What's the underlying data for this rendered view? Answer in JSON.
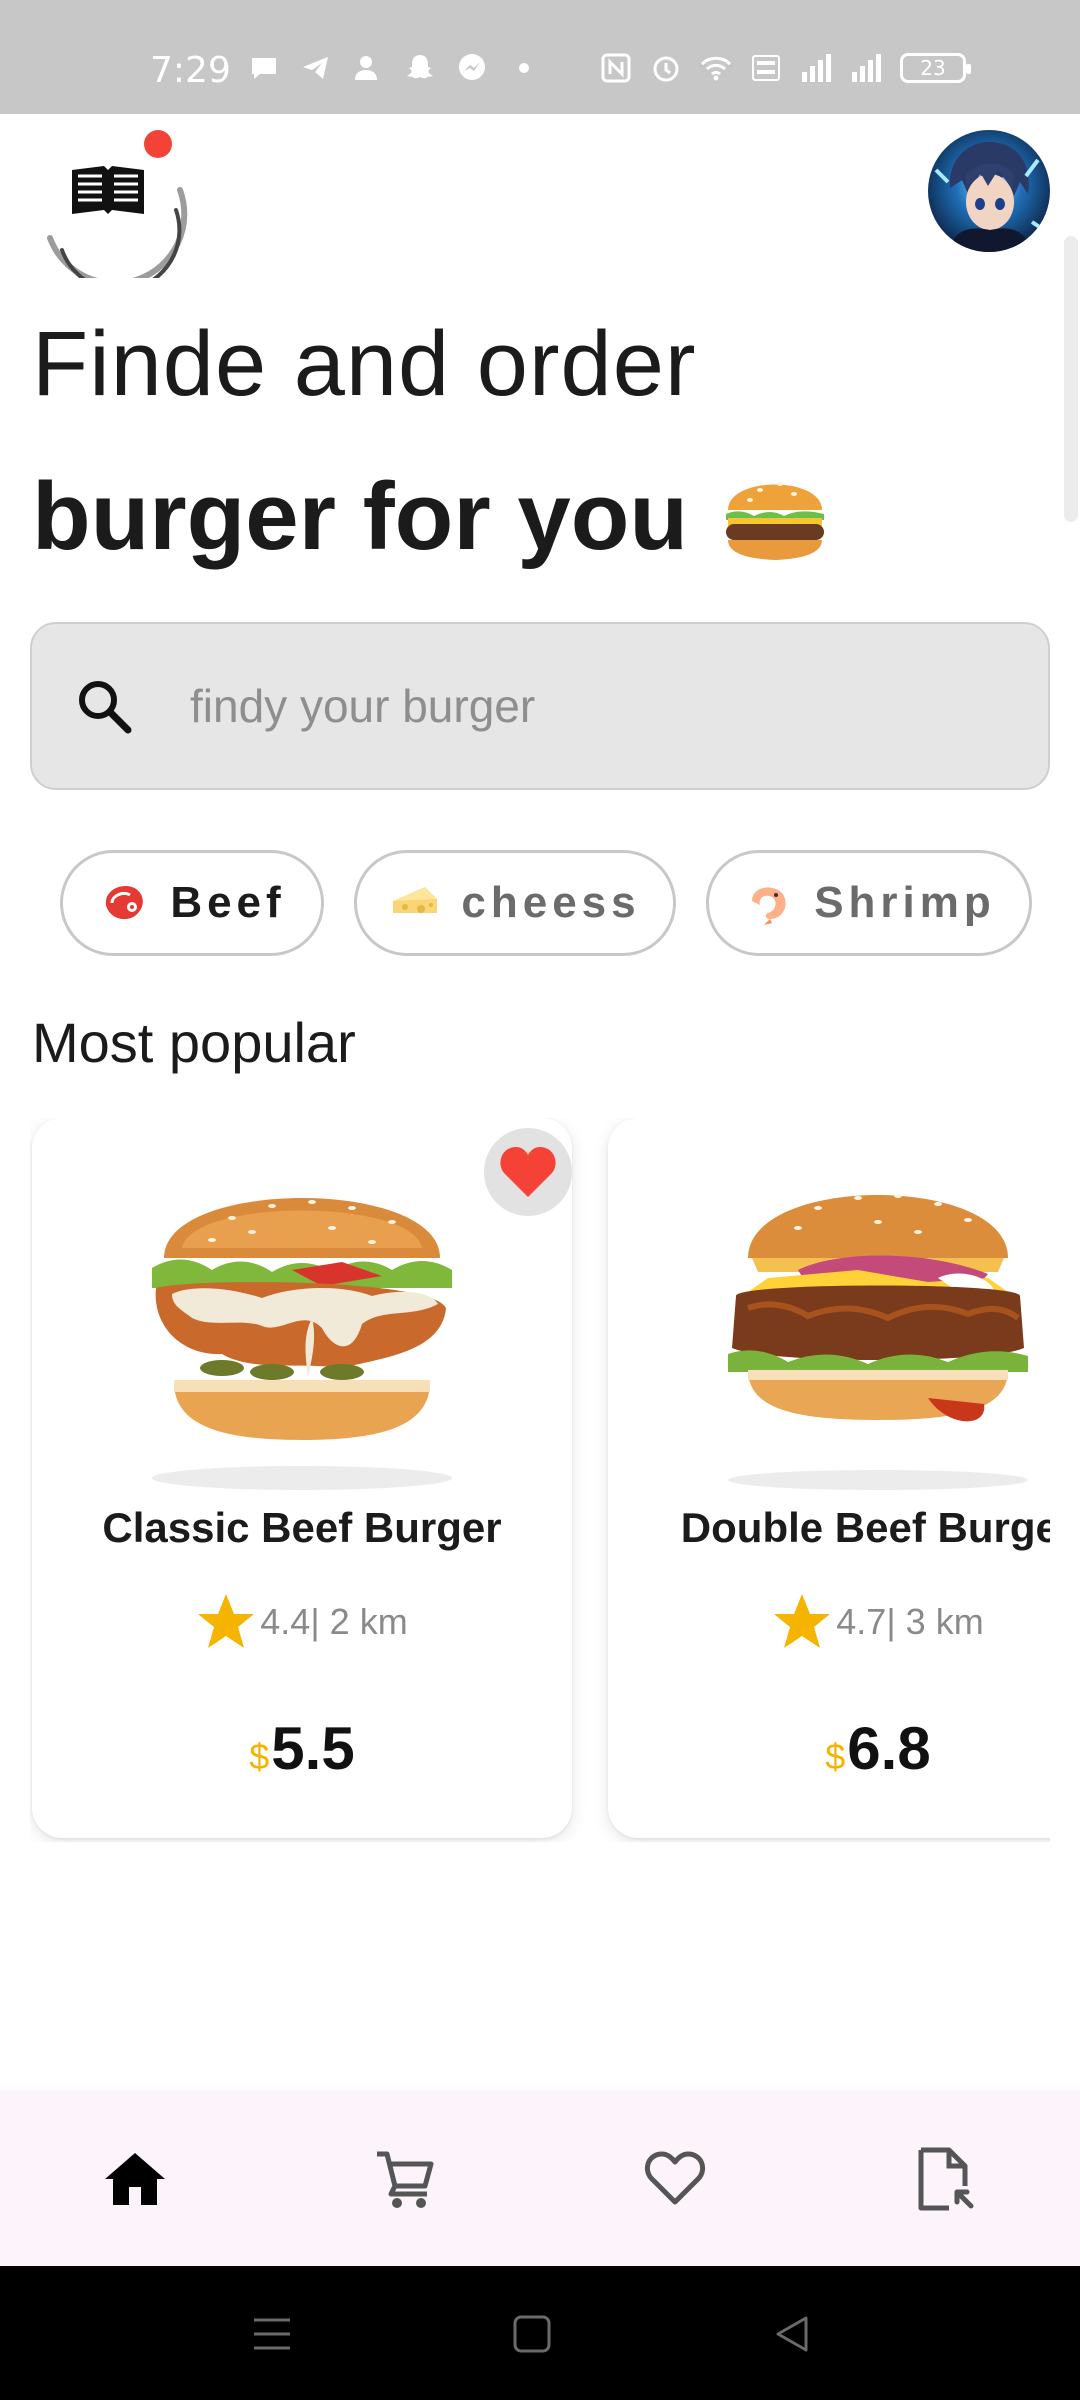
{
  "status_bar": {
    "time": "7:29",
    "battery": "23"
  },
  "header": {
    "logo_icon": "book-icon",
    "avatar_icon": "avatar"
  },
  "headline": {
    "line1": "Finde and order",
    "line2": "burger for you",
    "emoji_icon": "burger-emoji-icon"
  },
  "search": {
    "placeholder": "findy your burger",
    "icon": "search-icon"
  },
  "categories": [
    {
      "label": "Beef",
      "icon": "steak-icon",
      "selected": true
    },
    {
      "label": "cheess",
      "icon": "cheese-icon",
      "selected": false
    },
    {
      "label": "Shrimp",
      "icon": "shrimp-icon",
      "selected": false
    }
  ],
  "popular": {
    "title": "Most popular",
    "items": [
      {
        "name": "Classic Beef Burger",
        "rating": "4.4",
        "distance": "| 2 km",
        "currency": "$",
        "price": "5.5",
        "favorite": true
      },
      {
        "name": "Double Beef Burger",
        "rating": "4.7",
        "distance": "| 3 km",
        "currency": "$",
        "price": "6.8",
        "favorite": false
      }
    ]
  },
  "bottom_nav": {
    "items": [
      "home-icon",
      "cart-icon",
      "heart-icon",
      "orders-icon"
    ],
    "active": "home-icon"
  },
  "colors": {
    "accent_star": "#f4b400",
    "favorite_heart": "#f44336",
    "nav_background": "#fdf3fb"
  }
}
